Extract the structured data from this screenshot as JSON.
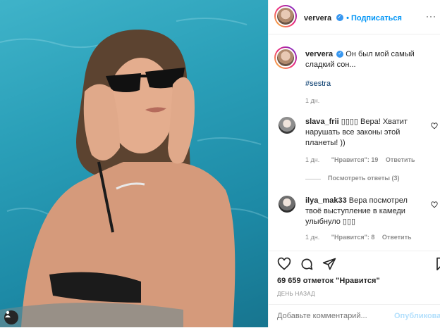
{
  "post": {
    "author": "ververa",
    "follow_label": "• Подписаться",
    "caption": "Он был мой самый сладкий сон...",
    "hashtag": "#sestra",
    "caption_time": "1 дн."
  },
  "comments": [
    {
      "user": "slava_frii",
      "text": "▯▯▯▯ Вера! Хватит нарушать все законы этой планеты! ))",
      "time": "1 дн.",
      "likes": "\"Нравится\": 19",
      "reply": "Ответить",
      "view_replies": "Посмотреть ответы (3)"
    },
    {
      "user": "ilya_mak33",
      "text": "Вера посмотрел твоё выступление в камеди улыбнуло ▯▯▯",
      "time": "1 дн.",
      "likes": "\"Нравится\": 8",
      "reply": "Ответить"
    }
  ],
  "stats": {
    "likes": "69 659 отметок \"Нравится\"",
    "date": "ДЕНЬ НАЗАД"
  },
  "comment_box": {
    "placeholder": "Добавьте комментарий...",
    "post_label": "Опубликовать"
  },
  "icons": [
    "heart-icon",
    "comment-icon",
    "share-icon",
    "bookmark-icon",
    "verified-icon",
    "user-tag-icon"
  ]
}
